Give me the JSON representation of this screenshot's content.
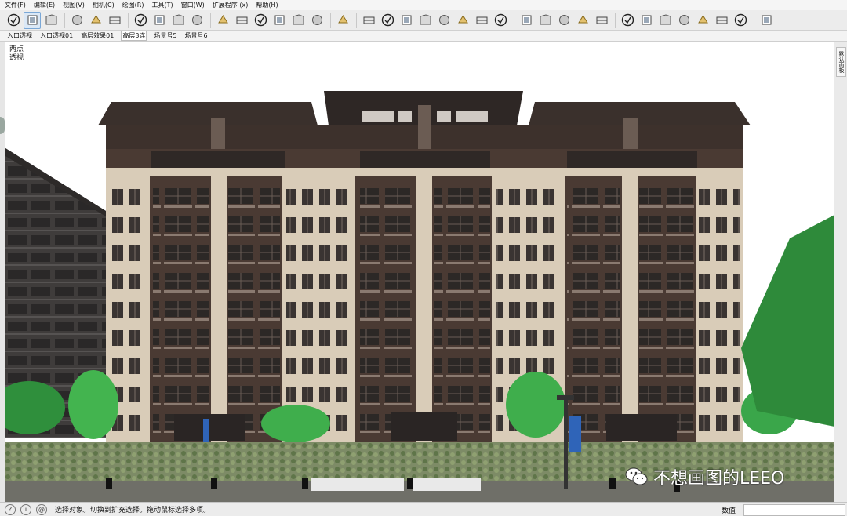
{
  "menu": {
    "items": [
      "文件(F)",
      "编辑(E)",
      "视图(V)",
      "相机(C)",
      "绘图(R)",
      "工具(T)",
      "窗口(W)",
      "扩展程序 (x)",
      "帮助(H)"
    ]
  },
  "toolbar": {
    "groups": [
      [
        "select-icon",
        "paint-bucket-icon",
        "eraser-icon"
      ],
      [
        "section-plane-icon",
        "section-display-icon",
        "section-cut-icon"
      ],
      [
        "shadows-icon",
        "fog-icon",
        "match-photo-icon",
        "edge-style-icon"
      ],
      [
        "xray-icon",
        "back-edges-icon",
        "wireframe-icon",
        "hidden-line-icon",
        "shaded-icon",
        "textured-icon"
      ],
      [
        "component-icon"
      ],
      [
        "tape-measure-icon",
        "protractor-icon",
        "dimension-icon",
        "axes-icon",
        "text-icon",
        "3d-text-icon",
        "label-icon",
        "orbit-icon"
      ],
      [
        "camera-icon",
        "box-icon",
        "cube-icon",
        "sandbox-icon",
        "sweep-icon"
      ],
      [
        "warehouse-icon",
        "extension-icon",
        "layout-icon",
        "ruby-icon",
        "send-icon",
        "share-icon",
        "reset-icon"
      ],
      [
        "leaf-icon"
      ]
    ]
  },
  "scenes": {
    "tabs": [
      "入口透视",
      "入口透视01",
      "高层效果01",
      "高层3连",
      "场景号5",
      "场景号6"
    ],
    "selected_index": 3
  },
  "viewport": {
    "label_line1": "两点",
    "label_line2": "透视"
  },
  "right_panel": {
    "tab_label": "默认面板"
  },
  "watermark": {
    "text": "不想画图的LEEO"
  },
  "status": {
    "message": "选择对象。切换到扩充选择。拖动鼠标选择多项。",
    "measure_label": "数值",
    "measure_value": ""
  },
  "colors": {
    "facade_dark": "#4a3a33",
    "facade_light": "#d9ccb8",
    "tree_green": "#3aa64a",
    "roof": "#2b2523",
    "accent_blue": "#2f64b8"
  }
}
